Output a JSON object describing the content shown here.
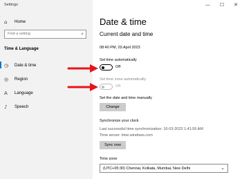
{
  "window": {
    "title": "Settings",
    "controls": [
      "—",
      "☐",
      "✕"
    ]
  },
  "sidebar": {
    "home_label": "Home",
    "search_placeholder": "Find a setting",
    "section_title": "Time & Language",
    "items": [
      {
        "label": "Date & time",
        "icon": "clock-icon",
        "active": true
      },
      {
        "label": "Region",
        "icon": "globe-icon"
      },
      {
        "label": "Language",
        "icon": "language-icon"
      },
      {
        "label": "Speech",
        "icon": "microphone-icon"
      }
    ]
  },
  "main": {
    "title": "Date & time",
    "current_heading": "Current date and time",
    "current_value": "08:40 PM, 03 April 2023",
    "set_time_auto": {
      "label": "Set time automatically",
      "state": "Off"
    },
    "set_zone_auto": {
      "label": "Set time zone automatically",
      "state": "Off"
    },
    "manual": {
      "label": "Set the date and time manually",
      "button": "Change"
    },
    "sync": {
      "heading": "Synchronize your clock",
      "last_sync": "Last successful time synchronization: 16-03-2023 1:41:55 AM",
      "server": "Time server: time.windows.com",
      "button": "Sync now"
    },
    "timezone": {
      "label": "Time zone",
      "value": "(UTC+05:30) Chennai, Kolkata, Mumbai, New Delhi"
    }
  },
  "colors": {
    "accent": "#0078d7",
    "annotation_arrow": "#e8141b"
  }
}
